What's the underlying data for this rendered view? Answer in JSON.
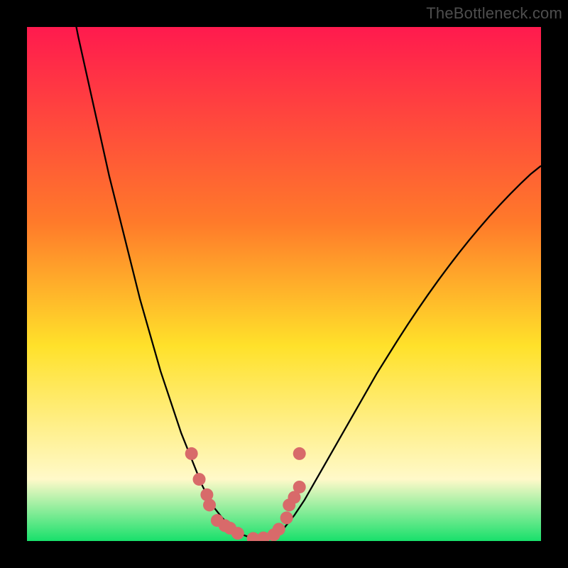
{
  "watermark": "TheBottleneck.com",
  "colors": {
    "frame": "#000000",
    "grad_top": "#ff1a4e",
    "grad_mid1": "#ff7a2a",
    "grad_mid2": "#ffe12a",
    "grad_low": "#fff9c9",
    "grad_bottom": "#18e06b",
    "curve": "#000000",
    "marker": "#d86a6a"
  },
  "chart_data": {
    "type": "line",
    "title": "",
    "xlabel": "",
    "ylabel": "",
    "xlim": [
      0,
      100
    ],
    "ylim": [
      0,
      100
    ],
    "series": [
      {
        "name": "bottleneck-curve",
        "x": [
          0,
          2,
          4,
          6,
          8,
          10,
          12,
          14,
          16,
          18,
          20,
          22,
          24,
          26,
          28,
          30,
          32,
          34,
          36,
          38,
          40,
          42,
          44,
          46,
          48,
          50,
          52,
          54,
          56,
          58,
          60,
          62,
          64,
          66,
          68,
          70,
          72,
          74,
          76,
          78,
          80,
          82,
          84,
          86,
          88,
          90,
          92,
          94,
          96,
          98,
          100
        ],
        "values": [
          150,
          140,
          131,
          118,
          108,
          98,
          89,
          80,
          71,
          63,
          55,
          47,
          40,
          33,
          27,
          21,
          16,
          11,
          7,
          4.5,
          2.5,
          1.2,
          0.5,
          0.2,
          1,
          2.5,
          5,
          8,
          11.5,
          15,
          18.5,
          22,
          25.5,
          29,
          32.5,
          35.7,
          38.9,
          42,
          45,
          47.9,
          50.7,
          53.4,
          56,
          58.5,
          60.9,
          63.2,
          65.4,
          67.5,
          69.5,
          71.4,
          73
        ]
      }
    ],
    "markers": [
      {
        "x": 32,
        "y": 17
      },
      {
        "x": 33.5,
        "y": 12
      },
      {
        "x": 35,
        "y": 9
      },
      {
        "x": 35.5,
        "y": 7
      },
      {
        "x": 37,
        "y": 4
      },
      {
        "x": 38.5,
        "y": 3
      },
      {
        "x": 39.5,
        "y": 2.5
      },
      {
        "x": 41,
        "y": 1.5
      },
      {
        "x": 44,
        "y": 0.5
      },
      {
        "x": 46,
        "y": 0.6
      },
      {
        "x": 48,
        "y": 1.2
      },
      {
        "x": 49,
        "y": 2.3
      },
      {
        "x": 50.5,
        "y": 4.5
      },
      {
        "x": 51,
        "y": 7
      },
      {
        "x": 52,
        "y": 8.5
      },
      {
        "x": 53,
        "y": 10.5
      },
      {
        "x": 53,
        "y": 17
      }
    ]
  }
}
